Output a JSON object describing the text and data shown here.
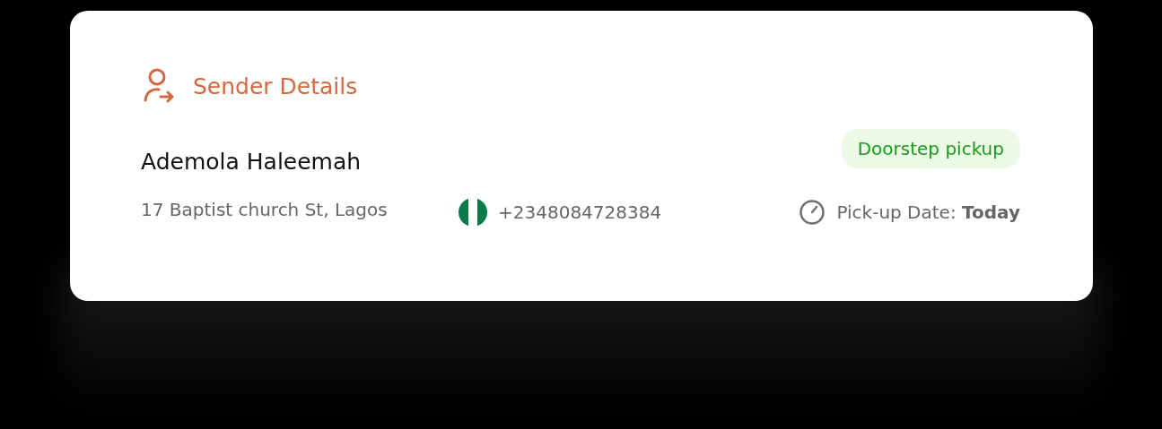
{
  "section": {
    "title": "Sender Details"
  },
  "sender": {
    "name": "Ademola Haleemah",
    "address": "17 Baptist church St, Lagos",
    "phone": "+2348084728384",
    "pickup_date": "Pick-up Date: **Today**"
  },
  "badge": {
    "label": "Doorstep pickup"
  }
}
